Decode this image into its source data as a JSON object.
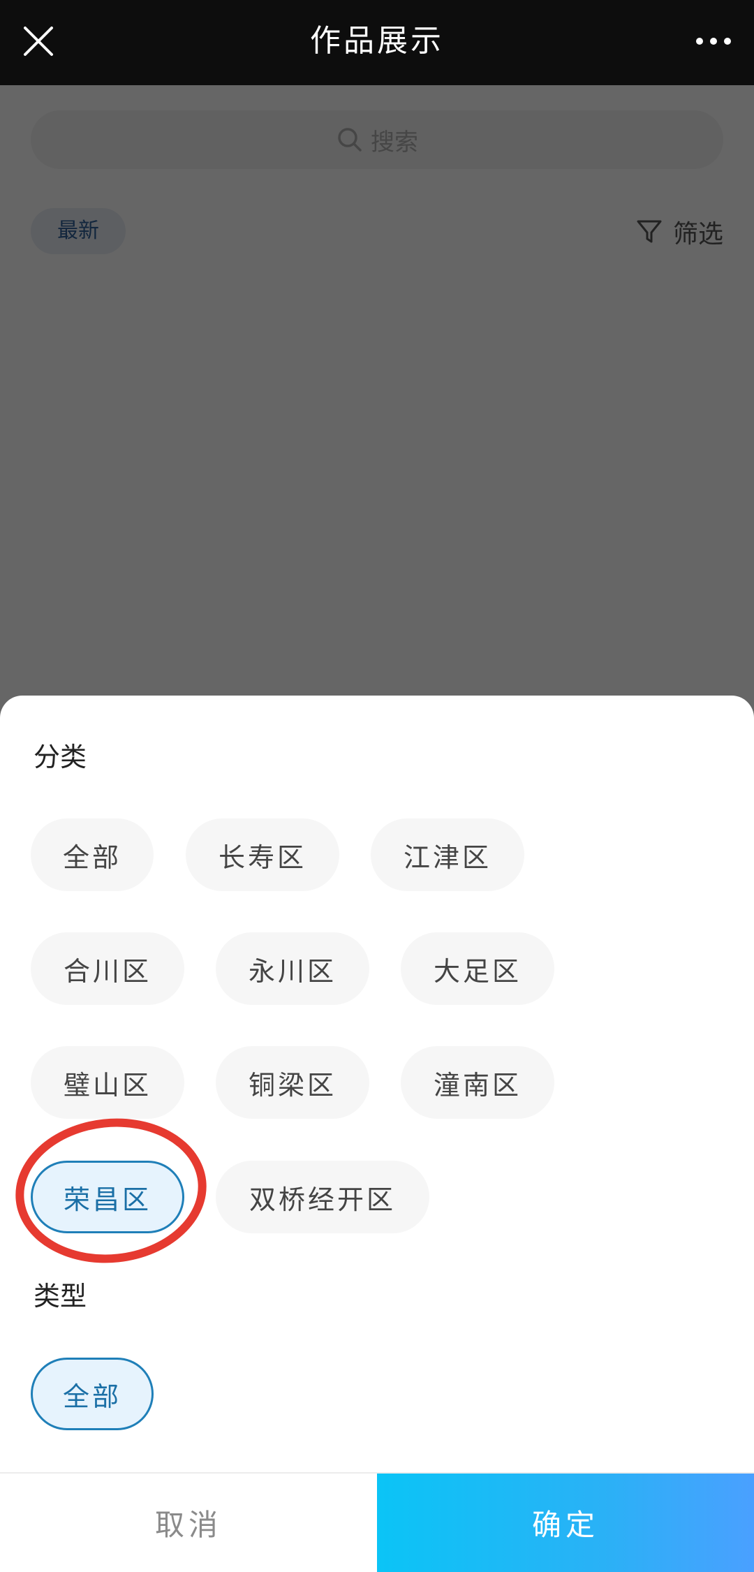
{
  "header": {
    "title": "作品展示",
    "close_icon": "close-icon",
    "more_icon": "more-icon"
  },
  "background": {
    "search_placeholder": "搜索",
    "sort_label": "最新",
    "filter_label": "筛选"
  },
  "sheet": {
    "category": {
      "title": "分类",
      "options": [
        "全部",
        "长寿区",
        "江津区",
        "合川区",
        "永川区",
        "大足区",
        "璧山区",
        "铜梁区",
        "潼南区",
        "荣昌区",
        "双桥经开区"
      ],
      "selected": "荣昌区"
    },
    "type": {
      "title": "类型",
      "options": [
        "全部"
      ],
      "selected": "全部"
    }
  },
  "footer": {
    "cancel_label": "取消",
    "confirm_label": "确定"
  },
  "colors": {
    "accent": "#1f7fb8",
    "highlight_ring": "#e63a30",
    "confirm_gradient_start": "#0bc4f6",
    "confirm_gradient_end": "#4aa0ff"
  }
}
